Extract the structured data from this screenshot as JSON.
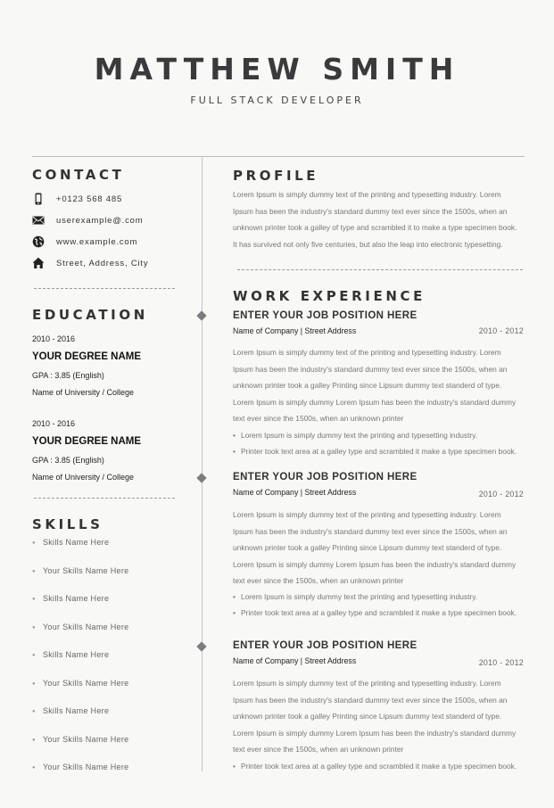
{
  "header": {
    "name": "MATTHEW SMITH",
    "title": "FULL STACK DEVELOPER"
  },
  "contact": {
    "heading": "CONTACT",
    "items": [
      {
        "icon": "phone-icon",
        "text": "+0123 568 485"
      },
      {
        "icon": "mail-icon",
        "text": "userexample@.com"
      },
      {
        "icon": "globe-icon",
        "text": "www.example.com"
      },
      {
        "icon": "home-icon",
        "text": "Street, Address, City"
      }
    ]
  },
  "education": {
    "heading": "EDUCATION",
    "entries": [
      {
        "years": "2010 - 2016",
        "degree": "YOUR DEGREE NAME",
        "gpa": "GPA : 3.85 (English)",
        "university": "Name of University / College"
      },
      {
        "years": "2010 - 2016",
        "degree": "YOUR DEGREE NAME",
        "gpa": "GPA : 3.85 (English)",
        "university": "Name of University / College"
      }
    ]
  },
  "skills": {
    "heading": "SKILLS",
    "items": [
      "Skills Name Here",
      "Your Skills Name Here",
      "Skills Name Here",
      "Your Skills Name Here",
      "Skills Name Here",
      "Your Skills Name Here",
      "Skills Name Here",
      "Your Skills Name Here",
      "Your Skills Name Here"
    ]
  },
  "profile": {
    "heading": "PROFILE",
    "lines": [
      "Lorem Ipsum is simply dummy text of the printing and typesetting industry. Lorem",
      "Ipsum has been the industry's standard dummy text ever since the 1500s, when an",
      "unknown printer took a galley of type and scrambled it to make a type specimen book.",
      "It has survived not only five centuries, but also the leap into electronic typesetting."
    ]
  },
  "experience": {
    "heading": "WORK EXPERIENCE",
    "jobs": [
      {
        "title": "ENTER YOUR JOB POSITION HERE",
        "company": "Name of Company | Street Address",
        "dates": "2010 - 2012",
        "lines": [
          "Lorem Ipsum is simply dummy text of the printing and typesetting industry. Lorem",
          "Ipsum has been the industry's standard dummy text ever since the 1500s, when an",
          "unknown printer took a galley Printing since Lipsum dummy text standerd of type.",
          "Lorem Ipsum is simply dummy Lorem Ipsum has been the industry's standard dummy",
          "text ever since the 1500s, when an unknown printer"
        ],
        "bullets": [
          "Lorem Ipsum is simply dummy text the printing and typesetting industry.",
          "Printer took text area at a galley type and scrambled it make a type specimen book."
        ]
      },
      {
        "title": "ENTER YOUR JOB POSITION HERE",
        "company": "Name of Company | Street Address",
        "dates": "2010 - 2012",
        "lines": [
          "Lorem Ipsum is simply dummy text of the printing and typesetting industry. Lorem",
          "Ipsum has been the industry's standard dummy text ever since the 1500s, when an",
          "unknown printer took a galley Printing since Lipsum dummy text standerd of type.",
          "Lorem Ipsum is simply dummy Lorem Ipsum has been the industry's standard dummy",
          "text ever since the 1500s, when an unknown printer"
        ],
        "bullets": [
          "Lorem Ipsum is simply dummy text the printing and typesetting industry.",
          "Printer took text area at a galley type and scrambled it make a type specimen book."
        ]
      },
      {
        "title": "ENTER YOUR JOB POSITION HERE",
        "company": "Name of Company | Street Address",
        "dates": "2010 - 2012",
        "lines": [
          "Lorem Ipsum is simply dummy text of the printing and typesetting industry. Lorem",
          "Ipsum has been the industry's standard dummy text ever since the 1500s, when an",
          "unknown printer took a galley Printing since Lipsum dummy text standerd of type.",
          "Lorem Ipsum is simply dummy Lorem Ipsum has been the industry's standard dummy",
          "text ever since the 1500s, when an unknown printer"
        ],
        "bullets": [
          "Printer took text area at a galley type and scrambled it make a type specimen book."
        ]
      }
    ]
  }
}
